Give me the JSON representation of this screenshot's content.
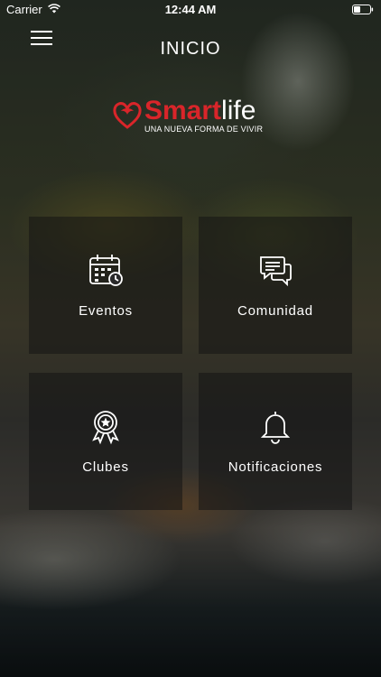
{
  "status_bar": {
    "carrier": "Carrier",
    "time": "12:44 AM",
    "icons": [
      "wifi-icon",
      "battery-icon"
    ]
  },
  "header": {
    "title": "INICIO",
    "menu_icon": "hamburger-menu-icon"
  },
  "logo": {
    "word_smart": "Smart",
    "word_life": "life",
    "tagline": "UNA NUEVA FORMA DE VIVIR",
    "brand_color": "#d9252a"
  },
  "tiles": [
    {
      "label": "Eventos",
      "icon": "calendar-icon"
    },
    {
      "label": "Comunidad",
      "icon": "chat-bubbles-icon"
    },
    {
      "label": "Clubes",
      "icon": "award-badge-icon"
    },
    {
      "label": "Notificaciones",
      "icon": "bell-icon"
    }
  ]
}
